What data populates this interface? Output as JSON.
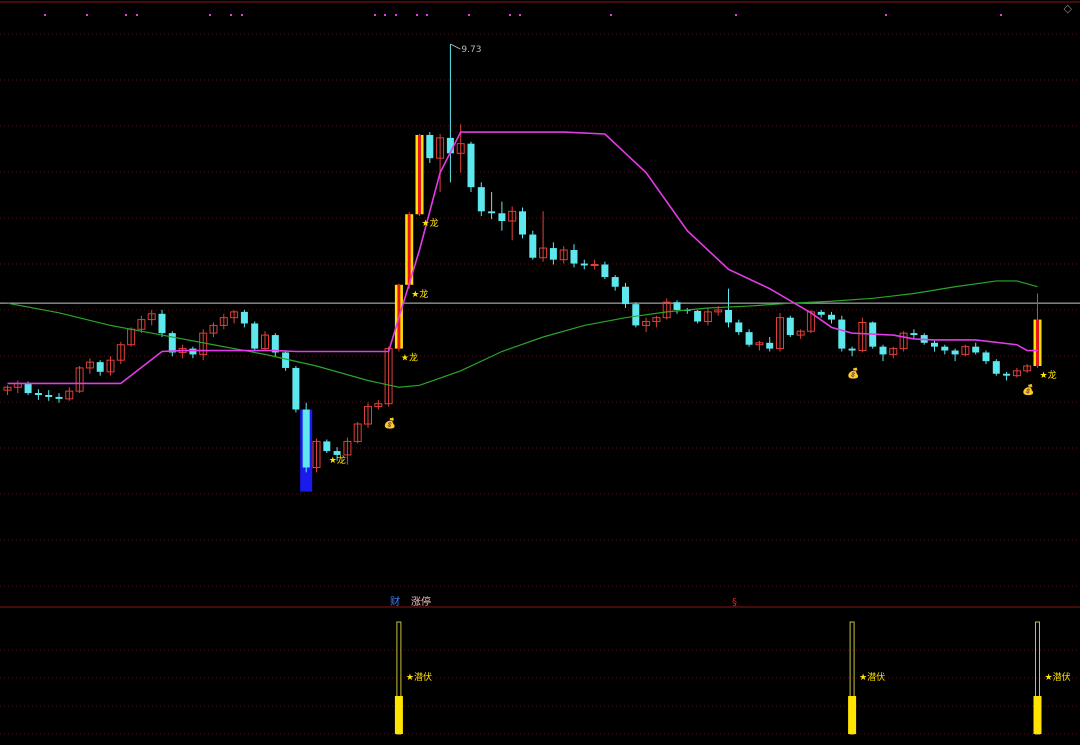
{
  "window": {
    "corner_icon": "diamond-icon"
  },
  "main_chart": {
    "high_price_label": "9.73",
    "signal_label": "★龙",
    "money_bag_icon": "money-bag-icon",
    "colors": {
      "up": "#e0403a",
      "down": "#5ee8ee",
      "ma_magenta": "#e23ce6",
      "ma_green": "#2aa52a",
      "signal": "#ffe400",
      "signal_red": "#e8141a",
      "grid": "#5a0f0f",
      "price_line": "#c8c8c8",
      "blue_bar": "#1a1aee"
    }
  },
  "sub_chart": {
    "marker_cai": "财",
    "marker_zhangting": "涨停",
    "marker_s": "§",
    "signal_label": "★潜伏"
  },
  "chart_data": {
    "type": "candlestick",
    "candles": [
      [
        6.15,
        6.2,
        6.1,
        6.18
      ],
      [
        6.18,
        6.25,
        6.12,
        6.22
      ],
      [
        6.22,
        6.24,
        6.1,
        6.12
      ],
      [
        6.12,
        6.16,
        6.05,
        6.1
      ],
      [
        6.1,
        6.15,
        6.04,
        6.08
      ],
      [
        6.08,
        6.12,
        6.02,
        6.06
      ],
      [
        6.06,
        6.18,
        6.04,
        6.14
      ],
      [
        6.14,
        6.4,
        6.12,
        6.38
      ],
      [
        6.38,
        6.48,
        6.32,
        6.44
      ],
      [
        6.44,
        6.46,
        6.3,
        6.34
      ],
      [
        6.34,
        6.5,
        6.3,
        6.46
      ],
      [
        6.46,
        6.65,
        6.42,
        6.62
      ],
      [
        6.62,
        6.8,
        6.6,
        6.78
      ],
      [
        6.78,
        6.92,
        6.74,
        6.88
      ],
      [
        6.88,
        6.98,
        6.82,
        6.94
      ],
      [
        6.94,
        6.98,
        6.7,
        6.74
      ],
      [
        6.74,
        6.76,
        6.5,
        6.54
      ],
      [
        6.54,
        6.62,
        6.48,
        6.58
      ],
      [
        6.58,
        6.6,
        6.48,
        6.52
      ],
      [
        6.52,
        6.78,
        6.46,
        6.74
      ],
      [
        6.74,
        6.85,
        6.7,
        6.82
      ],
      [
        6.82,
        6.94,
        6.78,
        6.9
      ],
      [
        6.9,
        6.98,
        6.84,
        6.96
      ],
      [
        6.96,
        6.98,
        6.8,
        6.84
      ],
      [
        6.84,
        6.86,
        6.55,
        6.58
      ],
      [
        6.58,
        6.76,
        6.56,
        6.72
      ],
      [
        6.72,
        6.74,
        6.5,
        6.54
      ],
      [
        6.54,
        6.56,
        6.35,
        6.38
      ],
      [
        6.38,
        6.4,
        5.92,
        5.95
      ],
      [
        5.95,
        6.02,
        5.3,
        5.35
      ],
      [
        5.35,
        5.65,
        5.3,
        5.62
      ],
      [
        5.62,
        5.64,
        5.5,
        5.52
      ],
      [
        5.52,
        5.56,
        5.42,
        5.48
      ],
      [
        5.48,
        5.66,
        5.38,
        5.62
      ],
      [
        5.62,
        5.82,
        5.6,
        5.8
      ],
      [
        5.8,
        6.02,
        5.76,
        5.98
      ],
      [
        5.98,
        6.05,
        5.95,
        6.01
      ],
      [
        6.01,
        6.6,
        5.98,
        6.58
      ],
      [
        6.58,
        7.25,
        6.55,
        7.24
      ],
      [
        7.24,
        7.99,
        7.2,
        7.97
      ],
      [
        7.97,
        8.8,
        7.95,
        8.79
      ],
      [
        8.79,
        8.82,
        8.5,
        8.55
      ],
      [
        8.55,
        8.8,
        8.2,
        8.76
      ],
      [
        8.76,
        9.73,
        8.3,
        8.6
      ],
      [
        8.6,
        8.9,
        8.4,
        8.7
      ],
      [
        8.7,
        8.72,
        8.2,
        8.25
      ],
      [
        8.25,
        8.3,
        7.95,
        8.0
      ],
      [
        8.0,
        8.2,
        7.92,
        7.98
      ],
      [
        7.98,
        8.1,
        7.8,
        7.9
      ],
      [
        7.9,
        8.05,
        7.7,
        8.0
      ],
      [
        8.0,
        8.04,
        7.72,
        7.76
      ],
      [
        7.76,
        7.8,
        7.5,
        7.52
      ],
      [
        7.52,
        8.0,
        7.48,
        7.62
      ],
      [
        7.62,
        7.68,
        7.45,
        7.5
      ],
      [
        7.5,
        7.64,
        7.46,
        7.6
      ],
      [
        7.6,
        7.66,
        7.42,
        7.46
      ],
      [
        7.46,
        7.5,
        7.4,
        7.44
      ],
      [
        7.44,
        7.5,
        7.4,
        7.45
      ],
      [
        7.45,
        7.48,
        7.3,
        7.32
      ],
      [
        7.32,
        7.34,
        7.18,
        7.22
      ],
      [
        7.22,
        7.26,
        7.0,
        7.04
      ],
      [
        7.04,
        7.06,
        6.8,
        6.82
      ],
      [
        6.82,
        6.9,
        6.75,
        6.86
      ],
      [
        6.86,
        6.92,
        6.8,
        6.9
      ],
      [
        6.9,
        7.1,
        6.88,
        7.06
      ],
      [
        7.06,
        7.08,
        6.94,
        6.98
      ],
      [
        6.98,
        7.0,
        6.94,
        6.97
      ],
      [
        6.97,
        6.98,
        6.84,
        6.86
      ],
      [
        6.86,
        7.0,
        6.82,
        6.96
      ],
      [
        6.96,
        7.02,
        6.92,
        6.98
      ],
      [
        6.98,
        7.2,
        6.8,
        6.85
      ],
      [
        6.85,
        6.88,
        6.72,
        6.75
      ],
      [
        6.75,
        6.78,
        6.6,
        6.62
      ],
      [
        6.62,
        6.66,
        6.56,
        6.64
      ],
      [
        6.64,
        6.7,
        6.55,
        6.58
      ],
      [
        6.58,
        6.95,
        6.55,
        6.9
      ],
      [
        6.9,
        6.92,
        6.7,
        6.72
      ],
      [
        6.72,
        6.78,
        6.68,
        6.76
      ],
      [
        6.76,
        6.98,
        6.74,
        6.96
      ],
      [
        6.96,
        6.98,
        6.9,
        6.93
      ],
      [
        6.93,
        6.96,
        6.84,
        6.88
      ],
      [
        6.88,
        6.92,
        6.55,
        6.58
      ],
      [
        6.58,
        6.6,
        6.5,
        6.56
      ],
      [
        6.56,
        6.9,
        6.54,
        6.85
      ],
      [
        6.85,
        6.86,
        6.58,
        6.6
      ],
      [
        6.6,
        6.62,
        6.45,
        6.52
      ],
      [
        6.52,
        6.6,
        6.48,
        6.58
      ],
      [
        6.58,
        6.76,
        6.55,
        6.74
      ],
      [
        6.74,
        6.78,
        6.68,
        6.72
      ],
      [
        6.72,
        6.74,
        6.62,
        6.64
      ],
      [
        6.64,
        6.66,
        6.55,
        6.6
      ],
      [
        6.6,
        6.62,
        6.52,
        6.56
      ],
      [
        6.56,
        6.58,
        6.45,
        6.52
      ],
      [
        6.52,
        6.62,
        6.5,
        6.6
      ],
      [
        6.6,
        6.64,
        6.52,
        6.54
      ],
      [
        6.54,
        6.56,
        6.42,
        6.45
      ],
      [
        6.45,
        6.47,
        6.3,
        6.32
      ],
      [
        6.32,
        6.34,
        6.25,
        6.3
      ],
      [
        6.3,
        6.38,
        6.28,
        6.35
      ],
      [
        6.35,
        6.42,
        6.33,
        6.4
      ],
      [
        6.4,
        7.15,
        6.38,
        6.88
      ]
    ],
    "ma_magenta": [
      [
        0,
        6.22
      ],
      [
        11,
        6.22
      ],
      [
        15,
        6.55
      ],
      [
        17,
        6.56
      ],
      [
        26,
        6.56
      ],
      [
        28,
        6.55
      ],
      [
        37,
        6.55
      ],
      [
        40,
        7.6
      ],
      [
        42,
        8.4
      ],
      [
        44,
        8.82
      ],
      [
        48,
        8.82
      ],
      [
        54,
        8.82
      ],
      [
        58,
        8.8
      ],
      [
        62,
        8.4
      ],
      [
        66,
        7.8
      ],
      [
        70,
        7.4
      ],
      [
        74,
        7.2
      ],
      [
        78,
        6.95
      ],
      [
        80,
        6.8
      ],
      [
        82,
        6.74
      ],
      [
        86,
        6.72
      ],
      [
        88,
        6.68
      ],
      [
        90,
        6.67
      ],
      [
        94,
        6.67
      ],
      [
        98,
        6.62
      ],
      [
        99,
        6.56
      ],
      [
        100,
        6.56
      ]
    ],
    "ma_green": [
      [
        0,
        7.05
      ],
      [
        5,
        6.95
      ],
      [
        10,
        6.82
      ],
      [
        15,
        6.72
      ],
      [
        20,
        6.62
      ],
      [
        25,
        6.52
      ],
      [
        30,
        6.4
      ],
      [
        35,
        6.25
      ],
      [
        38,
        6.18
      ],
      [
        40,
        6.2
      ],
      [
        44,
        6.35
      ],
      [
        48,
        6.55
      ],
      [
        52,
        6.7
      ],
      [
        56,
        6.82
      ],
      [
        60,
        6.9
      ],
      [
        64,
        6.96
      ],
      [
        68,
        7.0
      ],
      [
        72,
        7.02
      ],
      [
        76,
        7.05
      ],
      [
        80,
        7.07
      ],
      [
        84,
        7.1
      ],
      [
        88,
        7.15
      ],
      [
        92,
        7.22
      ],
      [
        96,
        7.28
      ],
      [
        98,
        7.28
      ],
      [
        100,
        7.22
      ]
    ],
    "price_line": 7.05,
    "dragon_signals": [
      31,
      38,
      39,
      40,
      100
    ],
    "money_bags": [
      37,
      82,
      99
    ],
    "qianfu_signals": [
      38,
      82,
      100
    ],
    "blue_bar": {
      "index": 29,
      "top": 5.95,
      "bottom": 5.1
    },
    "ylim": [
      4.0,
      10.0
    ]
  }
}
